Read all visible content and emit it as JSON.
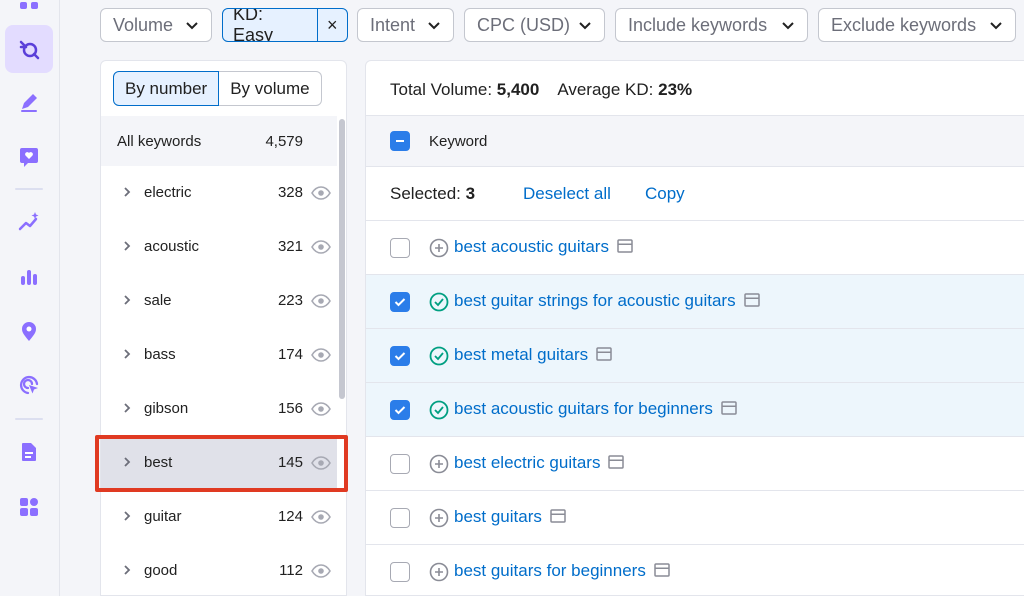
{
  "rail": {
    "icons": [
      "grid-icon",
      "keyword-strategy-icon",
      "edit-icon",
      "chat-heart-icon",
      "sparkle-chart-icon",
      "bar-chart-icon",
      "location-pin-icon",
      "target-click-icon",
      "document-icon",
      "apps-icon"
    ]
  },
  "filters": {
    "volume": "Volume",
    "kd": "KD: Easy",
    "kd_clear": "×",
    "intent": "Intent",
    "cpc": "CPC (USD)",
    "include": "Include keywords",
    "exclude": "Exclude keywords"
  },
  "groups_panel": {
    "by_number": "By number",
    "by_volume": "By volume",
    "all_label": "All keywords",
    "all_count": "4,579",
    "groups": [
      {
        "label": "electric",
        "count": "328"
      },
      {
        "label": "acoustic",
        "count": "321"
      },
      {
        "label": "sale",
        "count": "223"
      },
      {
        "label": "bass",
        "count": "174"
      },
      {
        "label": "gibson",
        "count": "156"
      },
      {
        "label": "best",
        "count": "145"
      },
      {
        "label": "guitar",
        "count": "124"
      },
      {
        "label": "good",
        "count": "112"
      }
    ]
  },
  "table": {
    "total_volume_label": "Total Volume:",
    "total_volume": "5,400",
    "avg_kd_label": "Average KD:",
    "avg_kd": "23%",
    "header_keyword": "Keyword",
    "selected_label": "Selected:",
    "selected_count": "3",
    "deselect_all": "Deselect all",
    "copy": "Copy",
    "rows": [
      {
        "keyword": "best acoustic guitars",
        "selected": false
      },
      {
        "keyword": "best guitar strings for acoustic guitars",
        "selected": true
      },
      {
        "keyword": "best metal guitars",
        "selected": true
      },
      {
        "keyword": "best acoustic guitars for beginners",
        "selected": true
      },
      {
        "keyword": "best electric guitars",
        "selected": false
      },
      {
        "keyword": "best guitars",
        "selected": false
      },
      {
        "keyword": "best guitars for beginners",
        "selected": false
      }
    ]
  },
  "colors": {
    "accent": "#006dca",
    "checkbox": "#2b7de9",
    "added": "#009f81",
    "highlight": "#e03a22",
    "rail_active": "#e3dcff",
    "rail_icon": "#8b6fff"
  }
}
